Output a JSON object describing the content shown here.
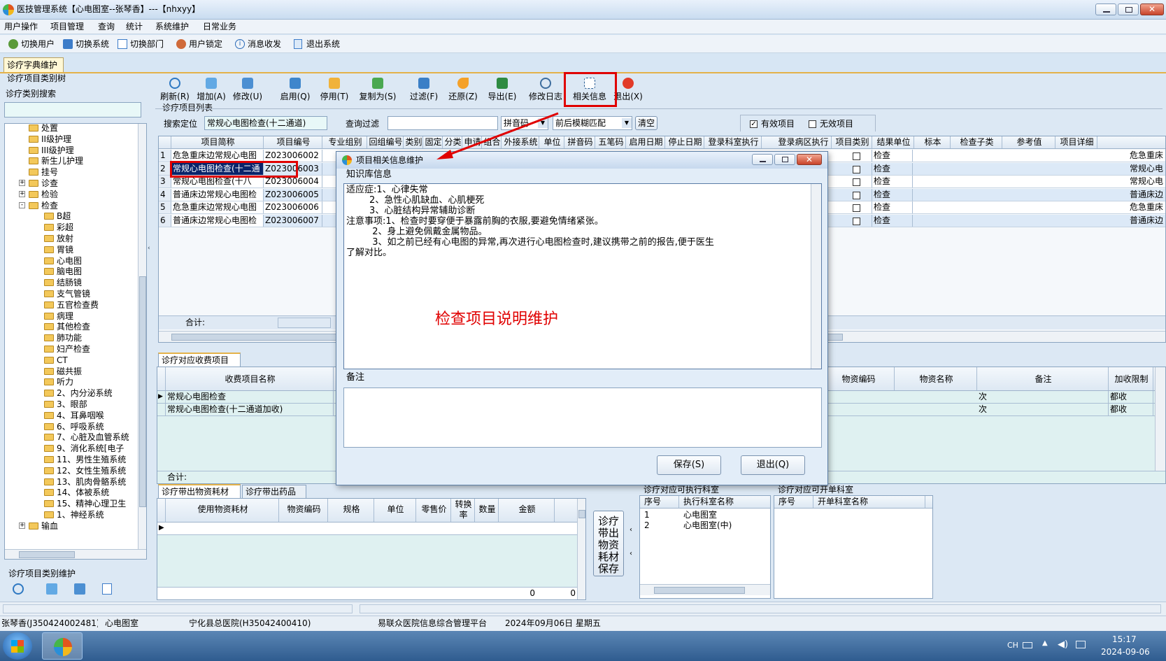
{
  "window": {
    "title": "医技管理系统【心电图室--张琴香】---【nhxyy】"
  },
  "menu": [
    "用户操作",
    "项目管理",
    "查询",
    "统计",
    "系统维护",
    "日常业务"
  ],
  "quickbar": [
    "切换用户",
    "切换系统",
    "切换部门",
    "用户锁定",
    "消息收发",
    "退出系统"
  ],
  "main_tab": "诊疗字典维护",
  "left": {
    "tree_title": "诊疗项目类别树",
    "search_label": "诊疗类别搜索",
    "search_value": "",
    "tree": [
      {
        "label": "处置",
        "level": 1
      },
      {
        "label": "II级护理",
        "level": 1
      },
      {
        "label": "III级护理",
        "level": 1
      },
      {
        "label": "新生儿护理",
        "level": 1
      },
      {
        "label": "挂号",
        "level": 1
      },
      {
        "label": "诊查",
        "level": 1,
        "toggle": "+"
      },
      {
        "label": "检验",
        "level": 1,
        "toggle": "+"
      },
      {
        "label": "检查",
        "level": 1,
        "toggle": "-"
      },
      {
        "label": "B超",
        "level": 2
      },
      {
        "label": "彩超",
        "level": 2
      },
      {
        "label": "放射",
        "level": 2
      },
      {
        "label": "胃镜",
        "level": 2
      },
      {
        "label": "心电图",
        "level": 2
      },
      {
        "label": "脑电图",
        "level": 2
      },
      {
        "label": "结肠镜",
        "level": 2
      },
      {
        "label": "支气管镜",
        "level": 2
      },
      {
        "label": "五官检查费",
        "level": 2
      },
      {
        "label": "病理",
        "level": 2
      },
      {
        "label": "其他检查",
        "level": 2
      },
      {
        "label": "肺功能",
        "level": 2
      },
      {
        "label": "妇产检查",
        "level": 2
      },
      {
        "label": "CT",
        "level": 2
      },
      {
        "label": "磁共振",
        "level": 2
      },
      {
        "label": "听力",
        "level": 2
      },
      {
        "label": "2、内分泌系统",
        "level": 2
      },
      {
        "label": "3、眼部",
        "level": 2
      },
      {
        "label": "4、耳鼻咽喉",
        "level": 2
      },
      {
        "label": "6、呼吸系统",
        "level": 2
      },
      {
        "label": "7、心脏及血管系统",
        "level": 2
      },
      {
        "label": "9、消化系统[电子",
        "level": 2
      },
      {
        "label": "11、男性生殖系统",
        "level": 2
      },
      {
        "label": "12、女性生殖系统",
        "level": 2
      },
      {
        "label": "13、肌肉骨骼系统",
        "level": 2
      },
      {
        "label": "14、体被系统",
        "level": 2
      },
      {
        "label": "15、精神心理卫生",
        "level": 2
      },
      {
        "label": "1、神经系统",
        "level": 2
      },
      {
        "label": "输血",
        "level": 1,
        "toggle": "+"
      }
    ],
    "maint_title": "诊疗项目类别维护"
  },
  "toolbar": [
    "刷新(R)",
    "增加(A)",
    "修改(U)",
    "启用(Q)",
    "停用(T)",
    "复制为(S)",
    "过滤(F)",
    "还原(Z)",
    "导出(E)",
    "修改日志",
    "相关信息",
    "退出(X)"
  ],
  "list": {
    "title": "诊疗项目列表",
    "search_label": "搜索定位",
    "search_value": "常规心电图检查(十二通道)",
    "filter_label": "查询过滤",
    "filter_value": "",
    "code_type": "拼音码",
    "match_type": "前后模糊匹配",
    "clear_btn": "清空",
    "valid_label": "有效项目",
    "invalid_label": "无效项目",
    "left_columns": [
      "项目简称",
      "项目编号",
      "专业组别",
      "回组编号",
      "类别",
      "固定",
      "分类",
      "申请",
      "组合",
      "外接系统",
      "单位",
      "拼音码",
      "五笔码",
      "启用日期",
      "停止日期",
      "登录科室执行"
    ],
    "right_columns": [
      "登录病区执行",
      "项目类别",
      "结果单位",
      "标本",
      "检查子类",
      "参考值",
      "项目详细"
    ],
    "rows": [
      {
        "no": "1",
        "name": "危急重床边常规心电图",
        "code": "Z023006002",
        "category": "检查",
        "detail": "危急重床"
      },
      {
        "no": "2",
        "name": "常规心电图检查(十二通",
        "code": "Z023006003",
        "category": "检查",
        "detail": "常规心电"
      },
      {
        "no": "3",
        "name": "常规心电图检查(十八",
        "code": "Z023006004",
        "category": "检查",
        "detail": "常规心电"
      },
      {
        "no": "4",
        "name": "普通床边常规心电图检",
        "code": "Z023006005",
        "category": "检查",
        "detail": "普通床边"
      },
      {
        "no": "5",
        "name": "危急重床边常规心电图",
        "code": "Z023006006",
        "category": "检查",
        "detail": "危急重床"
      },
      {
        "no": "6",
        "name": "普通床边常规心电图检",
        "code": "Z023006007",
        "category": "检查",
        "detail": "普通床边"
      }
    ],
    "total_label": "合计:"
  },
  "fee": {
    "tab": "诊疗对应收费项目",
    "col_name": "收费项目名称",
    "col_material_code": "物资编码",
    "col_material_name": "物资名称",
    "col_remark": "备注",
    "col_limit": "加收限制",
    "rows": [
      {
        "name": "常规心电图检查",
        "remark": "次",
        "limit": "都收"
      },
      {
        "name": "常规心电图检查(十二通道加收)",
        "remark": "次",
        "limit": "都收"
      }
    ],
    "total_label": "合计:"
  },
  "materials": {
    "tabs": [
      "诊疗带出物资耗材",
      "诊疗带出药品"
    ],
    "columns": [
      "使用物资耗材",
      "物资编码",
      "规格",
      "单位",
      "零售价",
      "转换率",
      "数量",
      "金额"
    ],
    "qty_total": "0",
    "amount_total": "0",
    "save_btn": "诊疗带出物资耗材保存"
  },
  "exec_dept": {
    "title": "诊疗对应可执行科室",
    "columns": [
      "序号",
      "执行科室名称"
    ],
    "rows": [
      {
        "no": "1",
        "name": "心电图室"
      },
      {
        "no": "2",
        "name": "心电图室(中)"
      }
    ]
  },
  "order_dept": {
    "title": "诊疗对应可开单科室",
    "columns": [
      "序号",
      "开单科室名称"
    ]
  },
  "dialog": {
    "title": "项目相关信息维护",
    "kb_label": "知识库信息",
    "kb_lines": [
      "适应症:1、心律失常",
      "        2、急性心肌缺血、心肌梗死",
      "        3、心脏结构异常辅助诊断",
      "注意事项:1、检查时要穿便于暴露前胸的衣服,要避免情绪紧张。",
      "         2、身上避免佩戴金属物品。",
      "         3、如之前已经有心电图的异常,再次进行心电图检查时,建议携带之前的报告,便于医生",
      "了解对比。"
    ],
    "remark_label": "备注",
    "save_btn": "保存(S)",
    "exit_btn": "退出(Q)"
  },
  "annotation": "检查项目说明维护",
  "status": [
    "张琴香(J350424002481)",
    "心电图室",
    "宁化县总医院(H35042400410)",
    "易联众医院信息综合管理平台",
    "2024年09月06日  星期五"
  ],
  "taskbar": {
    "lang": "CH",
    "time": "15:17",
    "date": "2024-09-06"
  },
  "colors": {
    "accent_red": "#e00000",
    "selected_row": "#dce9f7",
    "highlight_row": "#0a246a"
  }
}
